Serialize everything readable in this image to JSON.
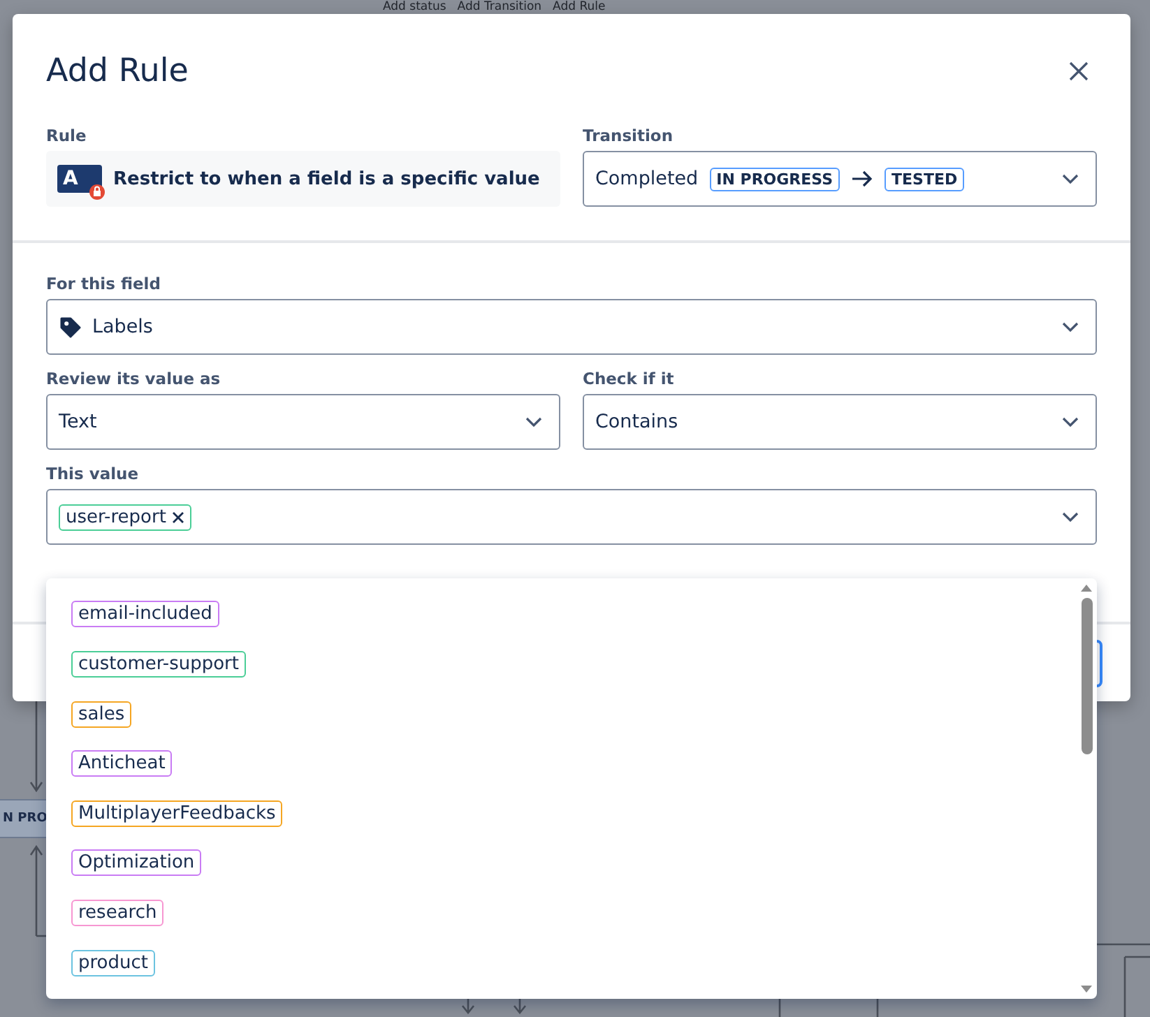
{
  "background": {
    "toolbar": [
      "Add status",
      "Add Transition",
      "Add Rule"
    ],
    "status_node": "N PRO"
  },
  "dialog": {
    "title": "Add Rule",
    "rule": {
      "label": "Rule",
      "icon_letter": "A",
      "text": "Restrict to when a field is a specific value"
    },
    "transition": {
      "label": "Transition",
      "name": "Completed",
      "from": "IN PROGRESS",
      "to": "TESTED"
    },
    "for_this_field": {
      "label": "For this field",
      "value": "Labels"
    },
    "review_as": {
      "label": "Review its value as",
      "value": "Text"
    },
    "check_if": {
      "label": "Check if it",
      "value": "Contains"
    },
    "this_value": {
      "label": "This value",
      "tags": [
        {
          "text": "user-report",
          "color": "#4bce97"
        }
      ]
    }
  },
  "options": [
    {
      "text": "email-included",
      "color": "#c97cf4"
    },
    {
      "text": "customer-support",
      "color": "#4bce97"
    },
    {
      "text": "sales",
      "color": "#f5a623"
    },
    {
      "text": "Anticheat",
      "color": "#c97cf4"
    },
    {
      "text": "MultiplayerFeedbacks",
      "color": "#f5a623"
    },
    {
      "text": "Optimization",
      "color": "#c97cf4"
    },
    {
      "text": "research",
      "color": "#f797d2"
    },
    {
      "text": "product",
      "color": "#6cc3e0"
    }
  ]
}
